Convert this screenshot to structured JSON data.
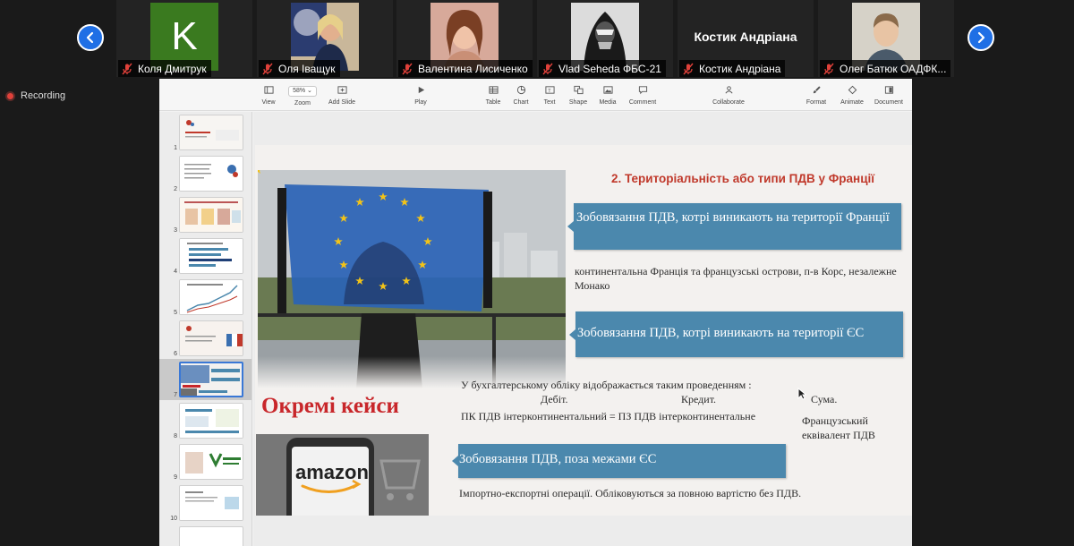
{
  "meeting": {
    "participants": [
      {
        "name": "Коля Дмитрук",
        "avatar_letter": "K",
        "avatar_color": "#3a7a1f"
      },
      {
        "name": "Оля Іващук"
      },
      {
        "name": "Валентина Лисиченко"
      },
      {
        "name": "Vlad Seheda ФБС-21"
      },
      {
        "name": "Костик Андріана",
        "display_name": "Костик Андріана"
      },
      {
        "name": "Олег Батюк ОАДФК..."
      }
    ],
    "recording_label": "Recording"
  },
  "app": {
    "toolbar": {
      "zoom_value": "58%",
      "items": [
        "View",
        "Zoom",
        "Add Slide",
        "Play",
        "Table",
        "Chart",
        "Text",
        "Shape",
        "Media",
        "Comment",
        "Collaborate",
        "Format",
        "Animate",
        "Document"
      ]
    },
    "slide_numbers": [
      "1",
      "2",
      "3",
      "4",
      "5",
      "6",
      "7",
      "8",
      "9",
      "10"
    ],
    "selected_slide": 7
  },
  "slide": {
    "title": "2. Територіальність або типи ПДВ у Франції",
    "ribbon1": "Зобовязання ПДВ, котрі виникають на території Франції",
    "text1": "континентальна Франція та французські острови, п-в Корс, незалежне Монако",
    "ribbon2": "Зобовязання ПДВ, котрі виникають на території ЄС",
    "cases_heading": "Окремі кейси",
    "posting_line": "У бухгалтерському обліку відображається таким проведенням :",
    "debit": "Дебіт.",
    "credit": "Кредит.",
    "sum": "Сума.",
    "posting_formula": "ПК ПДВ інтерконтинентальний = ПЗ ПДВ інтерконтинентальне",
    "french_equivalent": "Французський еквівалент ПДВ",
    "ribbon3": "Зобовязання ПДВ, поза межами ЄС",
    "text3": "Імпортно-експортні операції. Обліковуються за повною вартістю без ПДВ.",
    "amazon_logo": "amazon",
    "accent_red": "#c0392b",
    "ribbon_blue": "#4b88ad"
  }
}
